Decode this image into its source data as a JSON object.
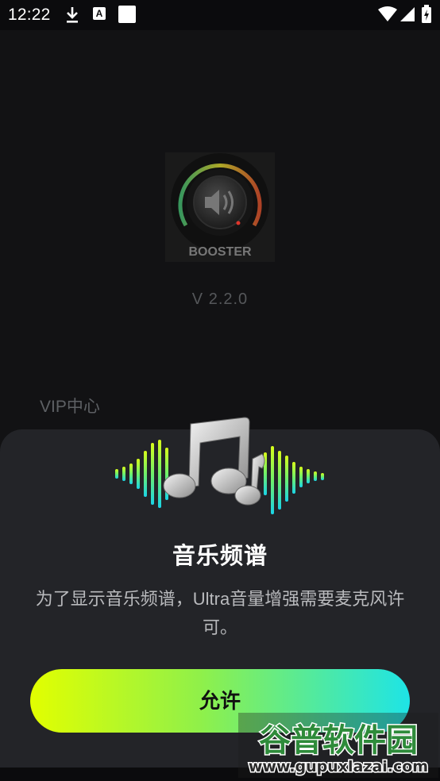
{
  "status_bar": {
    "time": "12:22",
    "icons": [
      "download-icon",
      "a-notification-icon",
      "square-notification-icon",
      "wifi-icon",
      "signal-icon",
      "battery-icon"
    ]
  },
  "app": {
    "logo_text": "BOOSTER",
    "version": "V 2.2.0",
    "vip_label": "VIP中心"
  },
  "dialog": {
    "title": "音乐频谱",
    "description": "为了显示音乐频谱，Ultra音量增强需要麦克风许可。",
    "allow_label": "允许",
    "art_icon": "music-notes-icon"
  },
  "watermark": {
    "brand": "谷普软件园",
    "url": "www.gupuxlazai.com"
  },
  "colors": {
    "background": "#121214",
    "sheet": "#232428",
    "button_gradient_start": "#e2ff00",
    "button_gradient_end": "#1ee4e6"
  }
}
